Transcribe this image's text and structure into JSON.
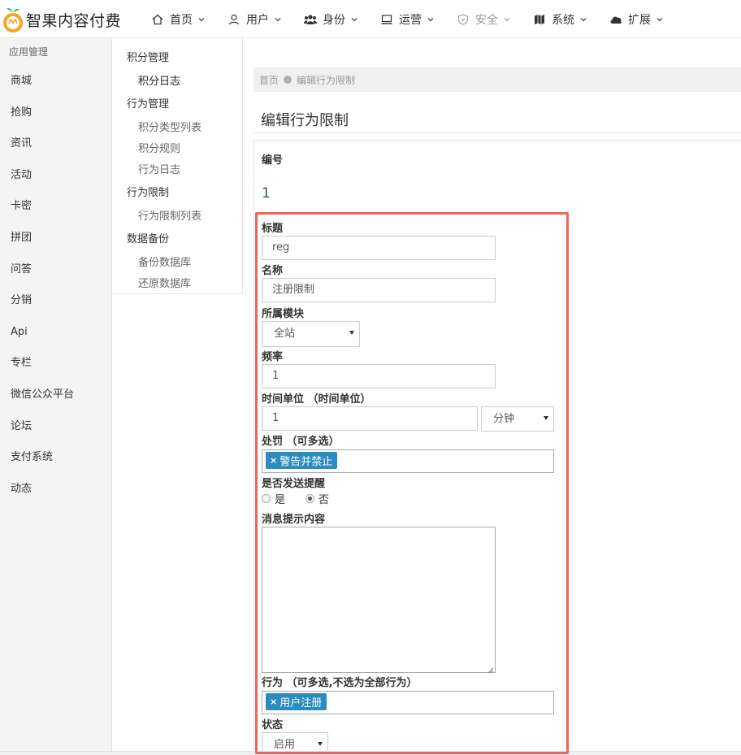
{
  "app": {
    "title": "智果内容付费"
  },
  "nav": [
    {
      "label": "首页",
      "icon": "home-icon"
    },
    {
      "label": "用户",
      "icon": "user-icon"
    },
    {
      "label": "身份",
      "icon": "users-icon"
    },
    {
      "label": "运营",
      "icon": "monitor-icon"
    },
    {
      "label": "安全",
      "icon": "shield-icon"
    },
    {
      "label": "系统",
      "icon": "map-icon"
    },
    {
      "label": "扩展",
      "icon": "cloud-icon"
    }
  ],
  "sidebar": {
    "header": "应用管理",
    "items": [
      "商城",
      "抢购",
      "资讯",
      "活动",
      "卡密",
      "拼团",
      "问答",
      "分销",
      "Api",
      "专栏",
      "微信公众平台",
      "论坛",
      "支付系统",
      "动态"
    ]
  },
  "subnav": {
    "groups": [
      {
        "label": "积分管理",
        "items": [
          "积分日志"
        ]
      },
      {
        "label": "行为管理",
        "items": [
          "积分类型列表",
          "积分规则",
          "行为日志"
        ]
      },
      {
        "label": "行为限制",
        "items": [
          "行为限制列表"
        ]
      },
      {
        "label": "数据备份",
        "items": [
          "备份数据库",
          "还原数据库"
        ]
      }
    ]
  },
  "breadcrumb": {
    "home": "首页",
    "current": "编辑行为限制"
  },
  "page": {
    "title": "编辑行为限制"
  },
  "form": {
    "id": {
      "label": "编号",
      "value": "1"
    },
    "title": {
      "label": "标题",
      "value": "reg"
    },
    "name": {
      "label": "名称",
      "value": "注册限制"
    },
    "module": {
      "label": "所属模块",
      "value": "全站"
    },
    "frequency": {
      "label": "频率",
      "value": "1"
    },
    "time_unit": {
      "label": "时间单位 （时间单位）",
      "value": "1",
      "unit": "分钟"
    },
    "punish": {
      "label": "处罚 （可多选）",
      "tag": "警告并禁止"
    },
    "remind": {
      "label": "是否发送提醒",
      "yes": "是",
      "no": "否",
      "selected": "no"
    },
    "message": {
      "label": "消息提示内容",
      "value": ""
    },
    "action": {
      "label": "行为 （可多选,不选为全部行为）",
      "tag": "用户注册"
    },
    "status": {
      "label": "状态",
      "value": "启用"
    }
  },
  "colors": {
    "tag": "#2d8cbf",
    "highlight": "#ef6454",
    "logo_orange": "#f5a623",
    "logo_leaf": "#5cb85c"
  }
}
